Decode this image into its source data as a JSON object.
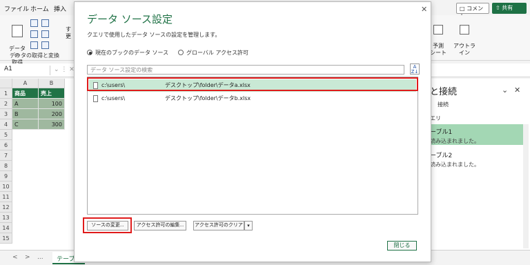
{
  "excel": {
    "menu": [
      "ファイル",
      "ホーム",
      "挿入"
    ],
    "ribbon": {
      "get_data_label": "データの\n取得",
      "refresh_label_partial": "す\n更",
      "group_label": "データの取得と変換",
      "forecast_label": "予測\nシート",
      "outline_label": "アウトラ\nイン"
    },
    "comment_label": "コメント",
    "share_label": "共有",
    "namebox": "A1",
    "fx_symbols": "⌄  ⋮  ✕",
    "columns": [
      "A",
      "B"
    ],
    "rows": [
      "1",
      "2",
      "3",
      "4",
      "5",
      "6",
      "7",
      "8",
      "9",
      "10",
      "11",
      "12",
      "13",
      "14",
      "15"
    ],
    "table": {
      "headers": [
        "商品",
        "売上"
      ],
      "rows": [
        [
          "A",
          "100"
        ],
        [
          "B",
          "200"
        ],
        [
          "C",
          "300"
        ]
      ]
    },
    "sheet_tab_label": "テーブル",
    "sheet_nav": [
      "<",
      ">",
      "..."
    ]
  },
  "queries_pane": {
    "title": "と接続",
    "tab_connections": "接続",
    "tab_queries_partial": "エリ",
    "items": [
      {
        "name": "ーブル1",
        "sub": "読み込まれました。"
      },
      {
        "name": "ーブル2",
        "sub": "読み込まれました。"
      }
    ]
  },
  "dialog": {
    "title": "データ ソース設定",
    "description": "クエリで使用したデータ ソースの設定を管理します。",
    "radio_current": "現在のブックのデータ ソース",
    "radio_global": "グローバル アクセス許可",
    "search_placeholder": "データ ソース設定の検索",
    "sources": [
      {
        "path_prefix": "c:\\users\\",
        "path_suffix": "デスクトップ\\folder\\データa.xlsx"
      },
      {
        "path_prefix": "c:\\users\\",
        "path_suffix": "デスクトップ\\folder\\データb.xlsx"
      }
    ],
    "btn_change_source": "ソースの変更...",
    "btn_edit_permissions": "アクセス許可の編集...",
    "btn_clear_permissions": "アクセス許可のクリア",
    "btn_close": "閉じる"
  }
}
